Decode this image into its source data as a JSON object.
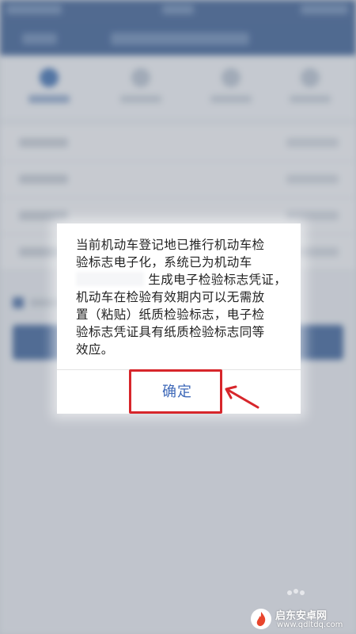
{
  "dialog": {
    "message_lines": [
      "当前机动车登记地已推行机动车检",
      "验标志电子化，系统已为机动车",
      "生成电子检验标志凭证，",
      "机动车在检验有效期内可以无需放",
      "置（粘贴）纸质检验标志，电子检",
      "验标志凭证具有纸质检验标志同等",
      "效应。"
    ],
    "confirm_label": "确定"
  },
  "colors": {
    "nav_blue": "#3b5e93",
    "confirm_text": "#3e68b8",
    "highlight_red": "#d7262b"
  },
  "watermark": {
    "title": "启东安卓网",
    "url": "www.qdltdq.com",
    "logo_icon": "fire-logo-icon"
  }
}
